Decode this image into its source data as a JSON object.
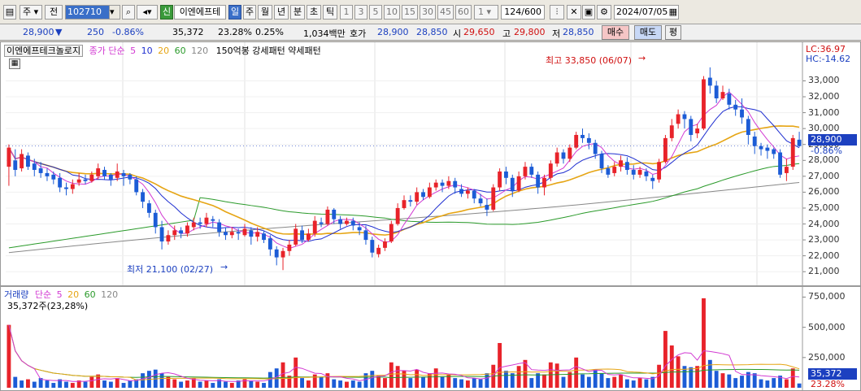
{
  "toolbar": {
    "code": "102710",
    "market": "주",
    "kind": "전",
    "sin": "신",
    "stock_name": "이엔에프테",
    "periods": [
      "일",
      "주",
      "월",
      "년",
      "분",
      "초",
      "틱"
    ],
    "intervals": [
      "1",
      "3",
      "5",
      "10",
      "15",
      "30",
      "45",
      "60",
      "1"
    ],
    "count": "124",
    "count_total": "/600",
    "date": "2024/07/05"
  },
  "quote": {
    "price": "28,900",
    "change": "250",
    "change_pct": "-0.86%",
    "volume": "35,372",
    "vol_ratio": "23.28%",
    "turnover": "0.25%",
    "amount": "1,034백만",
    "bid_label": "호가",
    "bid1": "28,900",
    "bid2": "28,850",
    "open_label": "시",
    "open": "29,650",
    "high_label": "고",
    "high": "29,800",
    "low_label": "저",
    "low": "28,850",
    "buy": "매수",
    "sell": "매도",
    "eval": "평"
  },
  "price_legend": {
    "name": "이엔에프테크놀로지",
    "ma_label": "종가 단순",
    "ma": [
      "5",
      "10",
      "20",
      "60",
      "120"
    ],
    "pattern": "150억봉 강세패턴  약세패턴"
  },
  "annotations": {
    "high": "최고 33,850 (06/07)",
    "low": "최저 21,100 (02/27)",
    "lc": "LC:36.97",
    "hc": "HC:-14.62",
    "cur_price": "28,900",
    "cur_pct": "-0.86%"
  },
  "price_axis": [
    "33,000",
    "32,000",
    "31,000",
    "30,000",
    "29,000",
    "28,000",
    "27,000",
    "26,000",
    "25,000",
    "24,000",
    "23,000",
    "22,000",
    "21,000"
  ],
  "volume_legend": {
    "label": "거래량",
    "ma_label": "단순",
    "ma": [
      "5",
      "20",
      "60",
      "120"
    ],
    "current": "35,372주(23,28%)"
  },
  "volume_axis": [
    "750,000",
    "500,000",
    "250,000"
  ],
  "volume_cur": "35,372",
  "volume_cur_pct": "23.28%",
  "colors": {
    "up": "#e8232a",
    "down": "#1c5cd6",
    "ma5": "#d23ad2",
    "ma10": "#1e2ed0",
    "ma20": "#e6a514",
    "ma60": "#2a9a2a",
    "ma120": "#888888"
  },
  "chart_data": {
    "type": "candlestick",
    "x_start": "2024-01",
    "x_end": "2024-07-05",
    "ylim": [
      20500,
      34200
    ],
    "candles": [
      [
        27600,
        28800,
        26400,
        29000
      ],
      [
        28000,
        27400,
        27000,
        28700
      ],
      [
        27500,
        28400,
        27300,
        28700
      ],
      [
        28300,
        27600,
        27400,
        28500
      ],
      [
        27800,
        27400,
        27000,
        28100
      ],
      [
        27500,
        27200,
        26900,
        27900
      ],
      [
        27200,
        27000,
        26700,
        27500
      ],
      [
        27100,
        26800,
        26500,
        27300
      ],
      [
        26900,
        26300,
        26000,
        27200
      ],
      [
        26300,
        26200,
        25800,
        26600
      ],
      [
        26200,
        26500,
        25900,
        26800
      ],
      [
        26600,
        26800,
        26400,
        27200
      ],
      [
        26800,
        26700,
        26500,
        27100
      ],
      [
        26700,
        27100,
        26600,
        27300
      ],
      [
        27000,
        27500,
        26800,
        27800
      ],
      [
        27400,
        27000,
        26800,
        27600
      ],
      [
        27100,
        26800,
        26400,
        27200
      ],
      [
        26900,
        27300,
        26700,
        27800
      ],
      [
        27200,
        27000,
        26400,
        27400
      ],
      [
        27100,
        26800,
        26500,
        27200
      ],
      [
        26800,
        26000,
        25800,
        27000
      ],
      [
        26000,
        25400,
        25000,
        26200
      ],
      [
        25300,
        24700,
        24400,
        25500
      ],
      [
        24700,
        23800,
        23400,
        24900
      ],
      [
        23800,
        22900,
        22400,
        24200
      ],
      [
        22900,
        23300,
        22700,
        23600
      ],
      [
        23300,
        23600,
        23000,
        23900
      ],
      [
        23600,
        23400,
        23100,
        23800
      ],
      [
        23400,
        23900,
        23200,
        24100
      ],
      [
        23800,
        24100,
        23600,
        24400
      ],
      [
        24100,
        24000,
        23700,
        24400
      ],
      [
        24000,
        24400,
        23800,
        24700
      ],
      [
        24300,
        24200,
        23800,
        24500
      ],
      [
        24100,
        23500,
        23200,
        24300
      ],
      [
        23500,
        23300,
        23000,
        23800
      ],
      [
        23300,
        23500,
        23100,
        23800
      ],
      [
        23500,
        23400,
        23000,
        23700
      ],
      [
        23300,
        23700,
        23200,
        24000
      ],
      [
        23600,
        23200,
        22700,
        23800
      ],
      [
        23200,
        23500,
        22900,
        23800
      ],
      [
        23400,
        23000,
        22800,
        23600
      ],
      [
        23100,
        22400,
        22000,
        23300
      ],
      [
        22400,
        21900,
        21400,
        22600
      ],
      [
        21900,
        22300,
        21100,
        22500
      ],
      [
        22300,
        22700,
        22000,
        23000
      ],
      [
        22700,
        23700,
        22600,
        24000
      ],
      [
        23600,
        23000,
        22800,
        23900
      ],
      [
        23000,
        23400,
        22900,
        23700
      ],
      [
        23400,
        24200,
        23200,
        24500
      ],
      [
        24100,
        24000,
        23800,
        24400
      ],
      [
        24000,
        24900,
        23900,
        25100
      ],
      [
        24900,
        24300,
        24000,
        25000
      ],
      [
        24300,
        24000,
        23700,
        24500
      ],
      [
        24000,
        24200,
        23900,
        24400
      ],
      [
        24200,
        23900,
        23600,
        24400
      ],
      [
        23800,
        23600,
        23300,
        24100
      ],
      [
        23600,
        23000,
        22700,
        23900
      ],
      [
        23000,
        22200,
        21900,
        23200
      ],
      [
        22100,
        22500,
        21900,
        22700
      ],
      [
        22500,
        22900,
        22300,
        23100
      ],
      [
        22900,
        24000,
        22800,
        24200
      ],
      [
        24000,
        25000,
        23900,
        25300
      ],
      [
        25000,
        25500,
        24900,
        25800
      ],
      [
        25500,
        25400,
        25100,
        25800
      ],
      [
        25400,
        26000,
        25200,
        26300
      ],
      [
        26000,
        25700,
        25500,
        26200
      ],
      [
        25700,
        26300,
        25600,
        26600
      ],
      [
        26300,
        26600,
        26100,
        26800
      ],
      [
        26600,
        26400,
        26000,
        26800
      ],
      [
        26400,
        26700,
        26200,
        27000
      ],
      [
        26700,
        26300,
        25900,
        26900
      ],
      [
        26200,
        25900,
        25700,
        26500
      ],
      [
        25900,
        26100,
        25600,
        26300
      ],
      [
        26100,
        25600,
        25300,
        26200
      ],
      [
        25600,
        25300,
        25100,
        25900
      ],
      [
        25200,
        24900,
        24500,
        25600
      ],
      [
        24900,
        26300,
        24800,
        26500
      ],
      [
        26300,
        27300,
        26100,
        27500
      ],
      [
        27300,
        26900,
        26500,
        27600
      ],
      [
        26900,
        26100,
        25700,
        27100
      ],
      [
        26100,
        27000,
        26000,
        27300
      ],
      [
        27000,
        27600,
        26800,
        27900
      ],
      [
        27600,
        27100,
        26900,
        27800
      ],
      [
        27100,
        26300,
        25900,
        27300
      ],
      [
        26300,
        26900,
        25800,
        27100
      ],
      [
        26900,
        27800,
        26700,
        28000
      ],
      [
        27800,
        28500,
        27600,
        28800
      ],
      [
        28500,
        28100,
        27800,
        28700
      ],
      [
        28100,
        28800,
        27900,
        29000
      ],
      [
        28800,
        29600,
        28700,
        29800
      ],
      [
        29600,
        29400,
        29100,
        30000
      ],
      [
        29400,
        29100,
        28700,
        29700
      ],
      [
        29100,
        28400,
        28100,
        29300
      ],
      [
        28400,
        27500,
        27200,
        28600
      ],
      [
        27500,
        27100,
        26900,
        27700
      ],
      [
        27200,
        27600,
        27000,
        27900
      ],
      [
        27600,
        28000,
        27300,
        28300
      ],
      [
        27900,
        27400,
        27100,
        28200
      ],
      [
        27400,
        27100,
        26800,
        27700
      ],
      [
        27100,
        27400,
        26900,
        27600
      ],
      [
        27300,
        27000,
        26700,
        27500
      ],
      [
        26900,
        26700,
        26200,
        27100
      ],
      [
        26800,
        27900,
        26600,
        28100
      ],
      [
        27900,
        29400,
        27800,
        29600
      ],
      [
        29400,
        30200,
        29200,
        30600
      ],
      [
        30300,
        30900,
        30000,
        31200
      ],
      [
        30900,
        30600,
        30000,
        31100
      ],
      [
        30600,
        29600,
        29200,
        30800
      ],
      [
        29700,
        30000,
        29400,
        30300
      ],
      [
        30000,
        33100,
        29900,
        33300
      ],
      [
        33200,
        32700,
        32200,
        33850
      ],
      [
        32700,
        31900,
        31600,
        33000
      ],
      [
        31900,
        32300,
        31800,
        32700
      ],
      [
        32200,
        31500,
        31200,
        32500
      ],
      [
        31500,
        31200,
        30800,
        31800
      ],
      [
        31200,
        30700,
        30300,
        31900
      ],
      [
        30600,
        29600,
        29000,
        30800
      ],
      [
        29500,
        28900,
        28400,
        29800
      ],
      [
        28900,
        28700,
        28300,
        29100
      ],
      [
        28800,
        28600,
        28100,
        29000
      ],
      [
        28700,
        28400,
        28100,
        28800
      ],
      [
        28500,
        27100,
        26900,
        28700
      ],
      [
        27200,
        27600,
        26700,
        28100
      ],
      [
        27600,
        29400,
        27400,
        29600
      ],
      [
        29300,
        28900,
        28850,
        29800
      ]
    ],
    "volume_ylim": [
      0,
      780000
    ],
    "volumes": [
      [
        520000,
        1
      ],
      [
        90000,
        0
      ],
      [
        60000,
        0
      ],
      [
        70000,
        1
      ],
      [
        50000,
        0
      ],
      [
        80000,
        0
      ],
      [
        60000,
        0
      ],
      [
        40000,
        0
      ],
      [
        70000,
        0
      ],
      [
        50000,
        0
      ],
      [
        40000,
        1
      ],
      [
        60000,
        1
      ],
      [
        50000,
        0
      ],
      [
        90000,
        1
      ],
      [
        110000,
        1
      ],
      [
        60000,
        0
      ],
      [
        50000,
        0
      ],
      [
        80000,
        1
      ],
      [
        40000,
        0
      ],
      [
        60000,
        0
      ],
      [
        70000,
        0
      ],
      [
        120000,
        0
      ],
      [
        140000,
        0
      ],
      [
        150000,
        0
      ],
      [
        120000,
        0
      ],
      [
        90000,
        1
      ],
      [
        70000,
        1
      ],
      [
        50000,
        0
      ],
      [
        60000,
        1
      ],
      [
        80000,
        1
      ],
      [
        50000,
        0
      ],
      [
        60000,
        1
      ],
      [
        40000,
        0
      ],
      [
        70000,
        0
      ],
      [
        50000,
        0
      ],
      [
        40000,
        1
      ],
      [
        60000,
        0
      ],
      [
        70000,
        1
      ],
      [
        60000,
        0
      ],
      [
        50000,
        1
      ],
      [
        40000,
        0
      ],
      [
        130000,
        0
      ],
      [
        160000,
        0
      ],
      [
        210000,
        1
      ],
      [
        100000,
        1
      ],
      [
        250000,
        1
      ],
      [
        80000,
        0
      ],
      [
        60000,
        1
      ],
      [
        110000,
        1
      ],
      [
        90000,
        0
      ],
      [
        120000,
        1
      ],
      [
        70000,
        0
      ],
      [
        60000,
        0
      ],
      [
        50000,
        1
      ],
      [
        60000,
        0
      ],
      [
        50000,
        0
      ],
      [
        120000,
        0
      ],
      [
        140000,
        0
      ],
      [
        100000,
        1
      ],
      [
        80000,
        1
      ],
      [
        210000,
        1
      ],
      [
        180000,
        1
      ],
      [
        140000,
        1
      ],
      [
        80000,
        0
      ],
      [
        150000,
        1
      ],
      [
        90000,
        0
      ],
      [
        120000,
        1
      ],
      [
        160000,
        1
      ],
      [
        90000,
        0
      ],
      [
        110000,
        1
      ],
      [
        80000,
        0
      ],
      [
        70000,
        0
      ],
      [
        60000,
        1
      ],
      [
        80000,
        0
      ],
      [
        70000,
        0
      ],
      [
        120000,
        0
      ],
      [
        190000,
        1
      ],
      [
        370000,
        1
      ],
      [
        140000,
        0
      ],
      [
        120000,
        0
      ],
      [
        180000,
        1
      ],
      [
        230000,
        1
      ],
      [
        80000,
        0
      ],
      [
        120000,
        0
      ],
      [
        110000,
        1
      ],
      [
        210000,
        1
      ],
      [
        200000,
        1
      ],
      [
        90000,
        0
      ],
      [
        130000,
        1
      ],
      [
        250000,
        1
      ],
      [
        110000,
        0
      ],
      [
        90000,
        0
      ],
      [
        150000,
        0
      ],
      [
        120000,
        0
      ],
      [
        80000,
        0
      ],
      [
        90000,
        1
      ],
      [
        110000,
        1
      ],
      [
        70000,
        0
      ],
      [
        60000,
        0
      ],
      [
        80000,
        1
      ],
      [
        70000,
        0
      ],
      [
        90000,
        0
      ],
      [
        190000,
        1
      ],
      [
        470000,
        1
      ],
      [
        350000,
        1
      ],
      [
        260000,
        1
      ],
      [
        180000,
        0
      ],
      [
        170000,
        0
      ],
      [
        180000,
        1
      ],
      [
        740000,
        1
      ],
      [
        230000,
        0
      ],
      [
        140000,
        0
      ],
      [
        120000,
        1
      ],
      [
        110000,
        0
      ],
      [
        80000,
        0
      ],
      [
        100000,
        0
      ],
      [
        130000,
        0
      ],
      [
        120000,
        0
      ],
      [
        70000,
        0
      ],
      [
        60000,
        0
      ],
      [
        80000,
        0
      ],
      [
        100000,
        0
      ],
      [
        70000,
        1
      ],
      [
        160000,
        1
      ],
      [
        35372,
        0
      ]
    ]
  }
}
